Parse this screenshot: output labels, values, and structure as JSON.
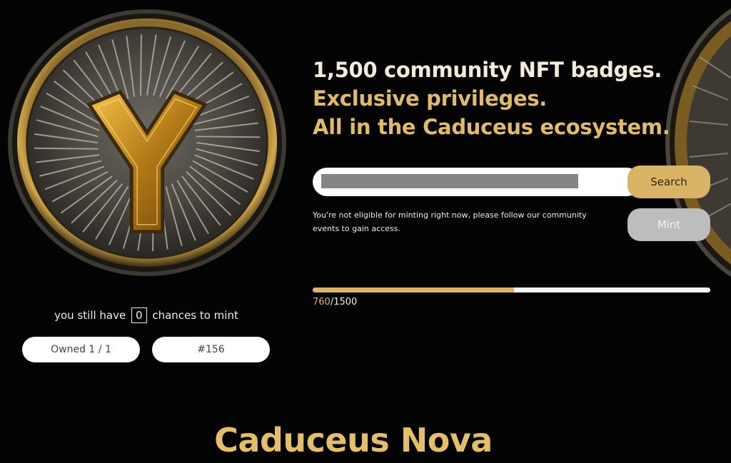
{
  "headline": {
    "line1": "1,500 community NFT badges.",
    "line2": "Exclusive privileges.",
    "line3": "All in the Caduceus ecosystem."
  },
  "search": {
    "value": "",
    "placeholder": "",
    "button_label": "Search"
  },
  "mint": {
    "button_label": "Mint",
    "enabled": false,
    "notice": "You're not eligible for minting right now, please follow our community events to gain access."
  },
  "progress": {
    "minted": "760",
    "separator": "/",
    "total": "1500",
    "fraction": 0.5067
  },
  "chances": {
    "prefix": "you still have",
    "count": "0",
    "suffix": "chances to mint"
  },
  "owned": {
    "label": "Owned",
    "value": "1 / 1"
  },
  "token_id": "#156",
  "brand": "Caduceus Nova",
  "colors": {
    "accent": "#d9b467",
    "background": "#030303",
    "mint_disabled": "#bdbdbd"
  },
  "icons": {
    "coin": "caduceus-y-rune-coin"
  }
}
